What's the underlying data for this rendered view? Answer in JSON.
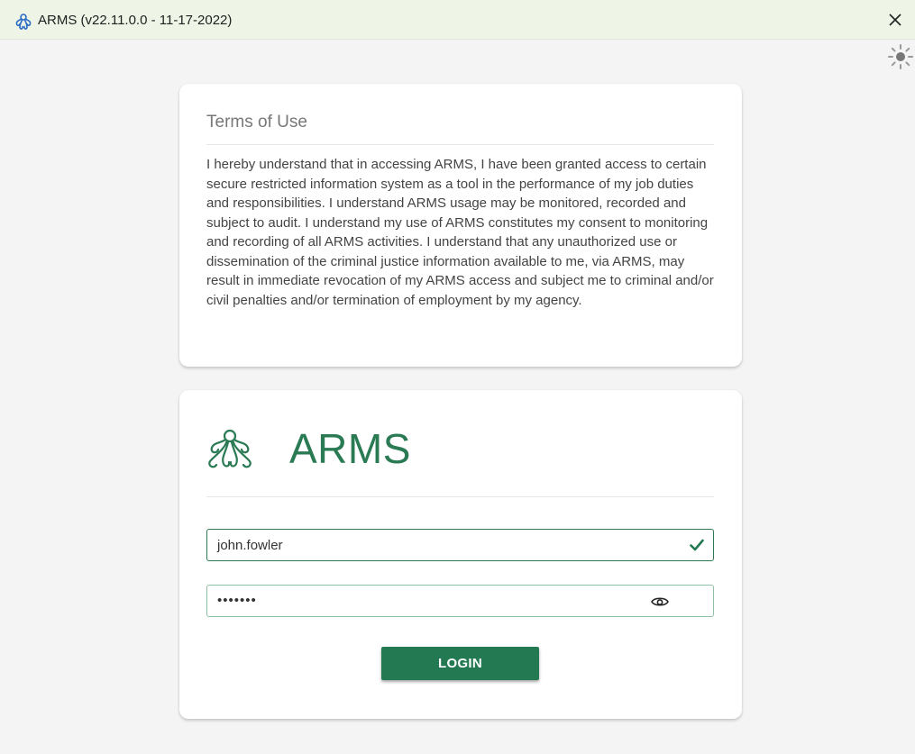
{
  "window": {
    "title": "ARMS (v22.11.0.0 - 11-17-2022)",
    "icon": "arms-logo-icon",
    "close_icon": "close-icon"
  },
  "theme_toggle": {
    "icon": "sun-icon"
  },
  "terms": {
    "heading": "Terms of Use",
    "body": "I hereby understand that in accessing ARMS, I have been granted access to certain secure restricted information system as a tool in the performance of my job duties and responsibilities. I understand ARMS usage may be monitored, recorded and subject to audit. I understand my use of ARMS constitutes my consent to monitoring and recording of all ARMS activities. I understand that any unauthorized use or dissemination of the criminal justice information available to me, via ARMS, may result in immediate revocation of my ARMS access and subject me to criminal and/or civil penalties and/or termination of employment by my agency."
  },
  "login": {
    "brand": "ARMS",
    "username": "john.fowler",
    "password_masked": "•••••••",
    "username_valid_icon": "checkmark-icon",
    "show_password_icon": "eye-icon",
    "button_label": "LOGIN"
  },
  "colors": {
    "brand_green": "#237a52",
    "titlebar_bg": "#eef5e6",
    "app_icon_blue": "#2b6cc4"
  }
}
